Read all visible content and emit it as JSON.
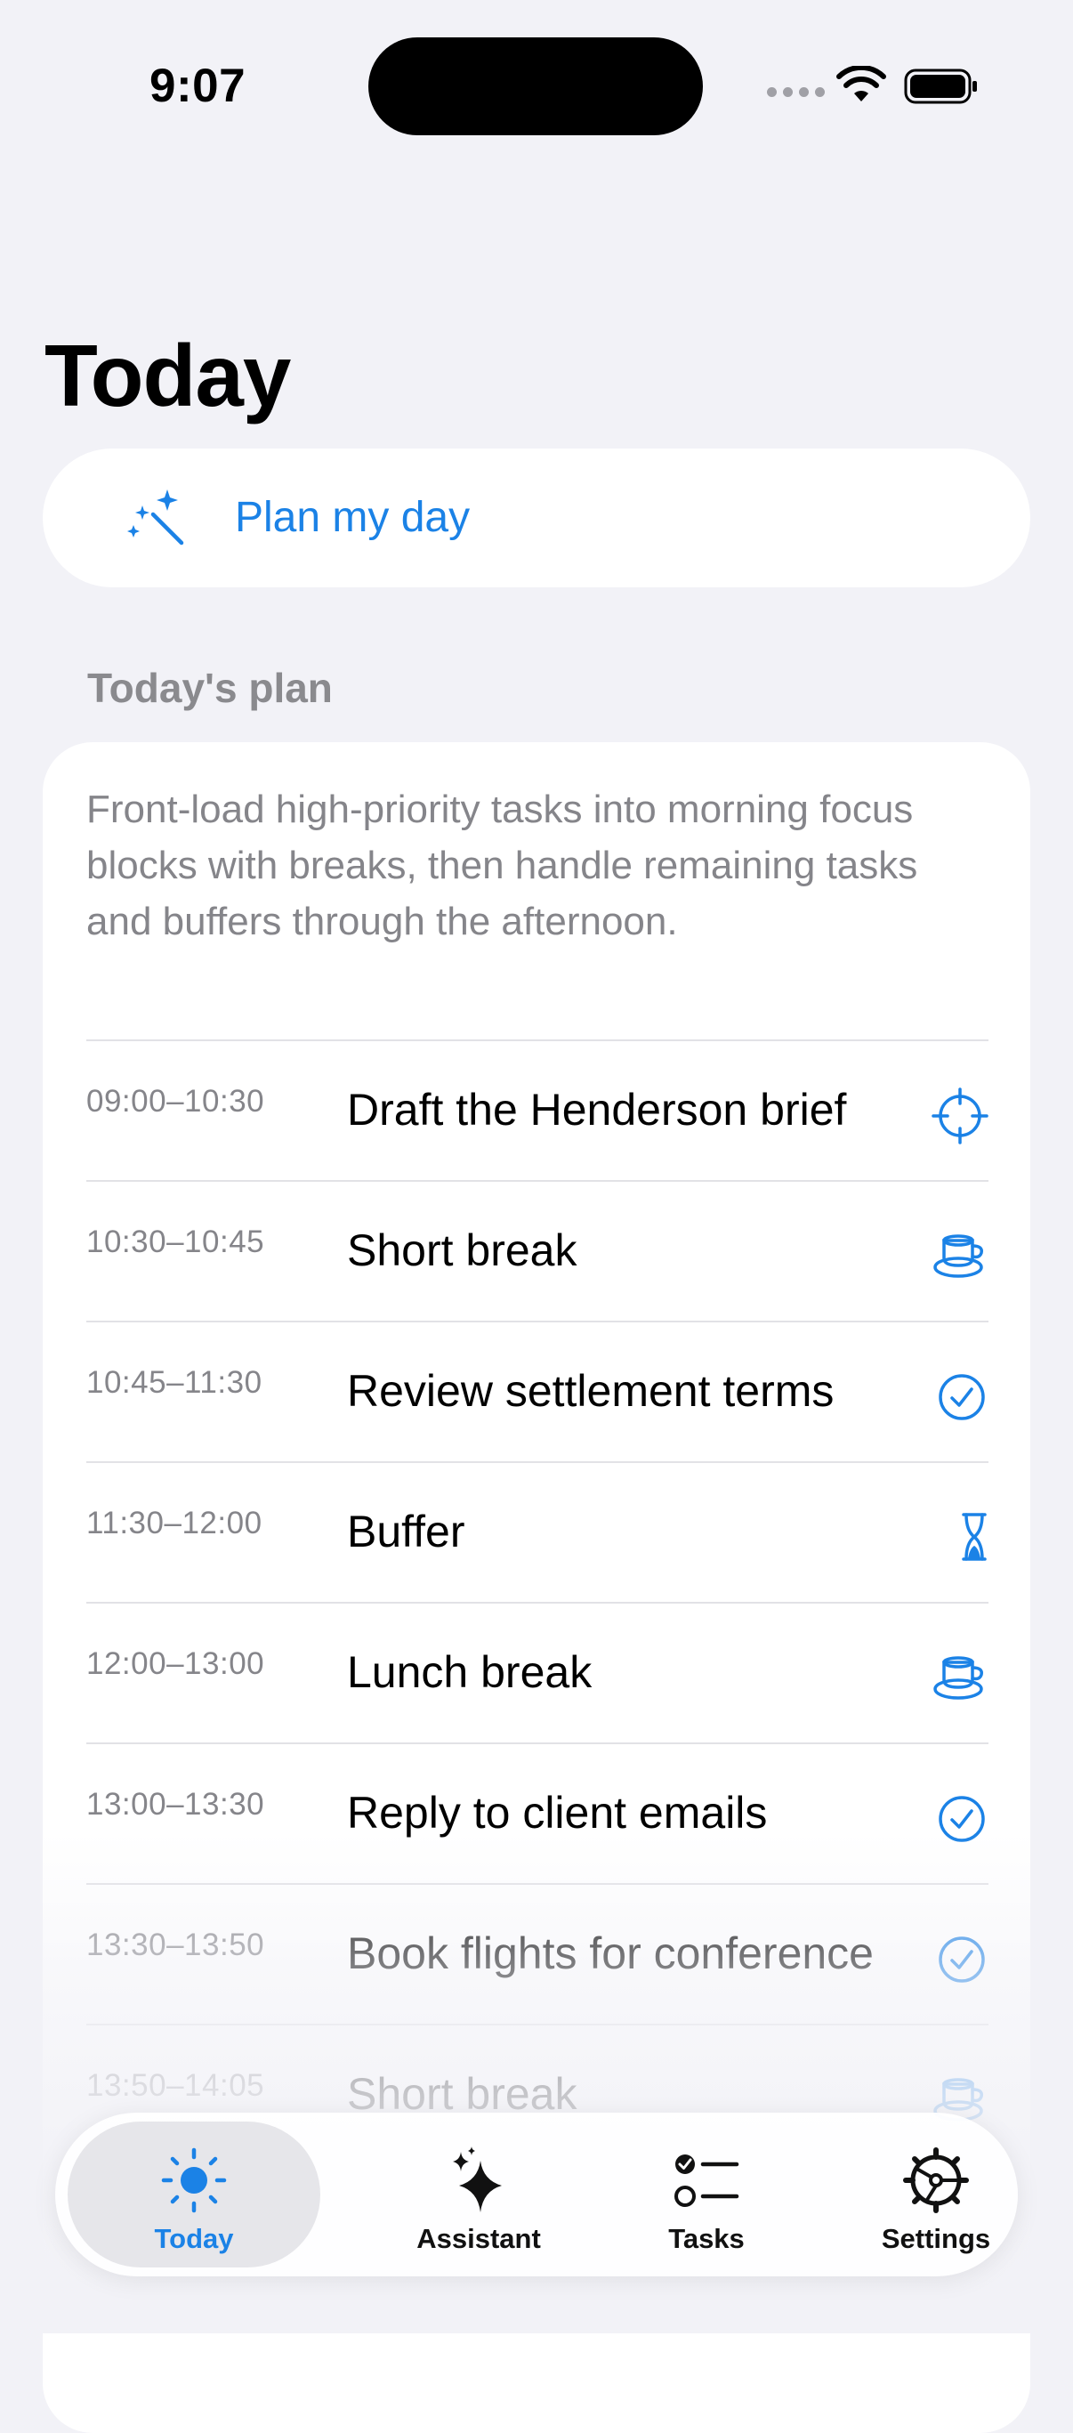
{
  "status_bar": {
    "time": "9:07"
  },
  "page_title": "Today",
  "plan_button": {
    "label": "Plan my day",
    "icon": "magic-wand-icon"
  },
  "section_header": "Today's plan",
  "plan": {
    "summary": "Front-load high-priority tasks into morning focus blocks with breaks, then handle remaining tasks and buffers through the afternoon.",
    "rows": [
      {
        "time": "09:00–10:30",
        "title": "Draft the Henderson brief",
        "icon": "focus-target-icon"
      },
      {
        "time": "10:30–10:45",
        "title": "Short break",
        "icon": "coffee-cup-icon"
      },
      {
        "time": "10:45–11:30",
        "title": "Review settlement terms",
        "icon": "checkmark-circle-icon"
      },
      {
        "time": "11:30–12:00",
        "title": "Buffer",
        "icon": "hourglass-icon"
      },
      {
        "time": "12:00–13:00",
        "title": "Lunch break",
        "icon": "coffee-cup-icon"
      },
      {
        "time": "13:00–13:30",
        "title": "Reply to client emails",
        "icon": "checkmark-circle-icon"
      },
      {
        "time": "13:30–13:50",
        "title": "Book flights for conference",
        "icon": "checkmark-circle-icon"
      },
      {
        "time": "13:50–14:05",
        "title": "Short break",
        "icon": "coffee-cup-icon"
      }
    ]
  },
  "tab_bar": {
    "tabs": [
      {
        "label": "Today",
        "icon": "sun-icon",
        "active": true
      },
      {
        "label": "Assistant",
        "icon": "sparkles-icon",
        "active": false
      },
      {
        "label": "Tasks",
        "icon": "checklist-icon",
        "active": false
      },
      {
        "label": "Settings",
        "icon": "gear-icon",
        "active": false
      }
    ]
  },
  "colors": {
    "accent": "#1b82e6",
    "background": "#f2f2f7",
    "secondary_text": "#85858a"
  }
}
